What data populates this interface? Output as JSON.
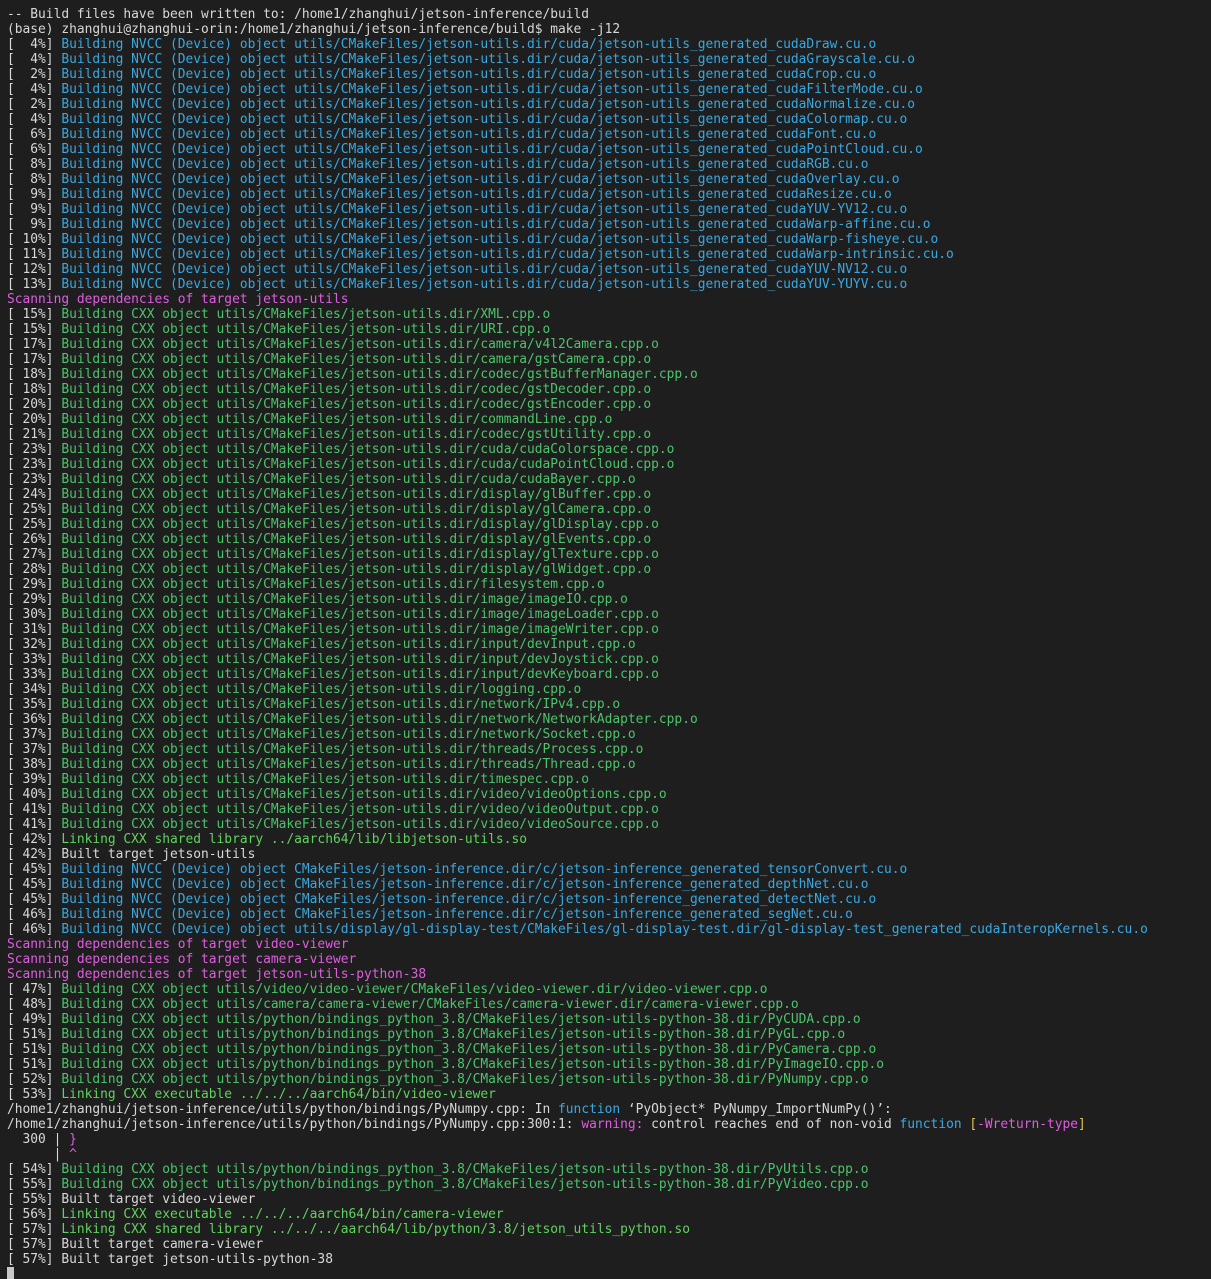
{
  "colors": {
    "background": "#1e1e1e",
    "default": "#d8d8d8",
    "nvcc": "#3aa8e0",
    "cxx": "#4cc46a",
    "scan": "#e05ce0",
    "link": "#5fd35f",
    "warning": "#e05ce0",
    "function_kw": "#3aa8e0",
    "brace": "#e05ce0",
    "flag": "#e05ce0",
    "bracket": "#e0c050"
  },
  "terminal": {
    "lines": [
      [
        {
          "t": "-- Build files have been written to: /home1/zhanghui/jetson-inference/build",
          "c": "default"
        }
      ],
      [
        {
          "t": "(base) zhanghui@zhanghui-orin:/home1/zhanghui/jetson-inference/build$ make -j12",
          "c": "default"
        }
      ],
      [
        {
          "t": "[  4%] ",
          "c": "default"
        },
        {
          "t": "Building NVCC (Device) object utils/CMakeFiles/jetson-utils.dir/cuda/jetson-utils_generated_cudaDraw.cu.o",
          "c": "nvcc"
        }
      ],
      [
        {
          "t": "[  4%] ",
          "c": "default"
        },
        {
          "t": "Building NVCC (Device) object utils/CMakeFiles/jetson-utils.dir/cuda/jetson-utils_generated_cudaGrayscale.cu.o",
          "c": "nvcc"
        }
      ],
      [
        {
          "t": "[  2%] ",
          "c": "default"
        },
        {
          "t": "Building NVCC (Device) object utils/CMakeFiles/jetson-utils.dir/cuda/jetson-utils_generated_cudaCrop.cu.o",
          "c": "nvcc"
        }
      ],
      [
        {
          "t": "[  4%] ",
          "c": "default"
        },
        {
          "t": "Building NVCC (Device) object utils/CMakeFiles/jetson-utils.dir/cuda/jetson-utils_generated_cudaFilterMode.cu.o",
          "c": "nvcc"
        }
      ],
      [
        {
          "t": "[  2%] ",
          "c": "default"
        },
        {
          "t": "Building NVCC (Device) object utils/CMakeFiles/jetson-utils.dir/cuda/jetson-utils_generated_cudaNormalize.cu.o",
          "c": "nvcc"
        }
      ],
      [
        {
          "t": "[  4%] ",
          "c": "default"
        },
        {
          "t": "Building NVCC (Device) object utils/CMakeFiles/jetson-utils.dir/cuda/jetson-utils_generated_cudaColormap.cu.o",
          "c": "nvcc"
        }
      ],
      [
        {
          "t": "[  6%] ",
          "c": "default"
        },
        {
          "t": "Building NVCC (Device) object utils/CMakeFiles/jetson-utils.dir/cuda/jetson-utils_generated_cudaFont.cu.o",
          "c": "nvcc"
        }
      ],
      [
        {
          "t": "[  6%] ",
          "c": "default"
        },
        {
          "t": "Building NVCC (Device) object utils/CMakeFiles/jetson-utils.dir/cuda/jetson-utils_generated_cudaPointCloud.cu.o",
          "c": "nvcc"
        }
      ],
      [
        {
          "t": "[  8%] ",
          "c": "default"
        },
        {
          "t": "Building NVCC (Device) object utils/CMakeFiles/jetson-utils.dir/cuda/jetson-utils_generated_cudaRGB.cu.o",
          "c": "nvcc"
        }
      ],
      [
        {
          "t": "[  8%] ",
          "c": "default"
        },
        {
          "t": "Building NVCC (Device) object utils/CMakeFiles/jetson-utils.dir/cuda/jetson-utils_generated_cudaOverlay.cu.o",
          "c": "nvcc"
        }
      ],
      [
        {
          "t": "[  9%] ",
          "c": "default"
        },
        {
          "t": "Building NVCC (Device) object utils/CMakeFiles/jetson-utils.dir/cuda/jetson-utils_generated_cudaResize.cu.o",
          "c": "nvcc"
        }
      ],
      [
        {
          "t": "[  9%] ",
          "c": "default"
        },
        {
          "t": "Building NVCC (Device) object utils/CMakeFiles/jetson-utils.dir/cuda/jetson-utils_generated_cudaYUV-YV12.cu.o",
          "c": "nvcc"
        }
      ],
      [
        {
          "t": "[  9%] ",
          "c": "default"
        },
        {
          "t": "Building NVCC (Device) object utils/CMakeFiles/jetson-utils.dir/cuda/jetson-utils_generated_cudaWarp-affine.cu.o",
          "c": "nvcc"
        }
      ],
      [
        {
          "t": "[ 10%] ",
          "c": "default"
        },
        {
          "t": "Building NVCC (Device) object utils/CMakeFiles/jetson-utils.dir/cuda/jetson-utils_generated_cudaWarp-fisheye.cu.o",
          "c": "nvcc"
        }
      ],
      [
        {
          "t": "[ 11%] ",
          "c": "default"
        },
        {
          "t": "Building NVCC (Device) object utils/CMakeFiles/jetson-utils.dir/cuda/jetson-utils_generated_cudaWarp-intrinsic.cu.o",
          "c": "nvcc"
        }
      ],
      [
        {
          "t": "[ 12%] ",
          "c": "default"
        },
        {
          "t": "Building NVCC (Device) object utils/CMakeFiles/jetson-utils.dir/cuda/jetson-utils_generated_cudaYUV-NV12.cu.o",
          "c": "nvcc"
        }
      ],
      [
        {
          "t": "[ 13%] ",
          "c": "default"
        },
        {
          "t": "Building NVCC (Device) object utils/CMakeFiles/jetson-utils.dir/cuda/jetson-utils_generated_cudaYUV-YUYV.cu.o",
          "c": "nvcc"
        }
      ],
      [
        {
          "t": "Scanning dependencies of target jetson-utils",
          "c": "scan"
        }
      ],
      [
        {
          "t": "[ 15%] ",
          "c": "default"
        },
        {
          "t": "Building CXX object utils/CMakeFiles/jetson-utils.dir/XML.cpp.o",
          "c": "cxx"
        }
      ],
      [
        {
          "t": "[ 15%] ",
          "c": "default"
        },
        {
          "t": "Building CXX object utils/CMakeFiles/jetson-utils.dir/URI.cpp.o",
          "c": "cxx"
        }
      ],
      [
        {
          "t": "[ 17%] ",
          "c": "default"
        },
        {
          "t": "Building CXX object utils/CMakeFiles/jetson-utils.dir/camera/v4l2Camera.cpp.o",
          "c": "cxx"
        }
      ],
      [
        {
          "t": "[ 17%] ",
          "c": "default"
        },
        {
          "t": "Building CXX object utils/CMakeFiles/jetson-utils.dir/camera/gstCamera.cpp.o",
          "c": "cxx"
        }
      ],
      [
        {
          "t": "[ 18%] ",
          "c": "default"
        },
        {
          "t": "Building CXX object utils/CMakeFiles/jetson-utils.dir/codec/gstBufferManager.cpp.o",
          "c": "cxx"
        }
      ],
      [
        {
          "t": "[ 18%] ",
          "c": "default"
        },
        {
          "t": "Building CXX object utils/CMakeFiles/jetson-utils.dir/codec/gstDecoder.cpp.o",
          "c": "cxx"
        }
      ],
      [
        {
          "t": "[ 20%] ",
          "c": "default"
        },
        {
          "t": "Building CXX object utils/CMakeFiles/jetson-utils.dir/codec/gstEncoder.cpp.o",
          "c": "cxx"
        }
      ],
      [
        {
          "t": "[ 20%] ",
          "c": "default"
        },
        {
          "t": "Building CXX object utils/CMakeFiles/jetson-utils.dir/commandLine.cpp.o",
          "c": "cxx"
        }
      ],
      [
        {
          "t": "[ 21%] ",
          "c": "default"
        },
        {
          "t": "Building CXX object utils/CMakeFiles/jetson-utils.dir/codec/gstUtility.cpp.o",
          "c": "cxx"
        }
      ],
      [
        {
          "t": "[ 23%] ",
          "c": "default"
        },
        {
          "t": "Building CXX object utils/CMakeFiles/jetson-utils.dir/cuda/cudaColorspace.cpp.o",
          "c": "cxx"
        }
      ],
      [
        {
          "t": "[ 23%] ",
          "c": "default"
        },
        {
          "t": "Building CXX object utils/CMakeFiles/jetson-utils.dir/cuda/cudaPointCloud.cpp.o",
          "c": "cxx"
        }
      ],
      [
        {
          "t": "[ 23%] ",
          "c": "default"
        },
        {
          "t": "Building CXX object utils/CMakeFiles/jetson-utils.dir/cuda/cudaBayer.cpp.o",
          "c": "cxx"
        }
      ],
      [
        {
          "t": "[ 24%] ",
          "c": "default"
        },
        {
          "t": "Building CXX object utils/CMakeFiles/jetson-utils.dir/display/glBuffer.cpp.o",
          "c": "cxx"
        }
      ],
      [
        {
          "t": "[ 25%] ",
          "c": "default"
        },
        {
          "t": "Building CXX object utils/CMakeFiles/jetson-utils.dir/display/glCamera.cpp.o",
          "c": "cxx"
        }
      ],
      [
        {
          "t": "[ 25%] ",
          "c": "default"
        },
        {
          "t": "Building CXX object utils/CMakeFiles/jetson-utils.dir/display/glDisplay.cpp.o",
          "c": "cxx"
        }
      ],
      [
        {
          "t": "[ 26%] ",
          "c": "default"
        },
        {
          "t": "Building CXX object utils/CMakeFiles/jetson-utils.dir/display/glEvents.cpp.o",
          "c": "cxx"
        }
      ],
      [
        {
          "t": "[ 27%] ",
          "c": "default"
        },
        {
          "t": "Building CXX object utils/CMakeFiles/jetson-utils.dir/display/glTexture.cpp.o",
          "c": "cxx"
        }
      ],
      [
        {
          "t": "[ 28%] ",
          "c": "default"
        },
        {
          "t": "Building CXX object utils/CMakeFiles/jetson-utils.dir/display/glWidget.cpp.o",
          "c": "cxx"
        }
      ],
      [
        {
          "t": "[ 29%] ",
          "c": "default"
        },
        {
          "t": "Building CXX object utils/CMakeFiles/jetson-utils.dir/filesystem.cpp.o",
          "c": "cxx"
        }
      ],
      [
        {
          "t": "[ 29%] ",
          "c": "default"
        },
        {
          "t": "Building CXX object utils/CMakeFiles/jetson-utils.dir/image/imageIO.cpp.o",
          "c": "cxx"
        }
      ],
      [
        {
          "t": "[ 30%] ",
          "c": "default"
        },
        {
          "t": "Building CXX object utils/CMakeFiles/jetson-utils.dir/image/imageLoader.cpp.o",
          "c": "cxx"
        }
      ],
      [
        {
          "t": "[ 31%] ",
          "c": "default"
        },
        {
          "t": "Building CXX object utils/CMakeFiles/jetson-utils.dir/image/imageWriter.cpp.o",
          "c": "cxx"
        }
      ],
      [
        {
          "t": "[ 32%] ",
          "c": "default"
        },
        {
          "t": "Building CXX object utils/CMakeFiles/jetson-utils.dir/input/devInput.cpp.o",
          "c": "cxx"
        }
      ],
      [
        {
          "t": "[ 33%] ",
          "c": "default"
        },
        {
          "t": "Building CXX object utils/CMakeFiles/jetson-utils.dir/input/devJoystick.cpp.o",
          "c": "cxx"
        }
      ],
      [
        {
          "t": "[ 33%] ",
          "c": "default"
        },
        {
          "t": "Building CXX object utils/CMakeFiles/jetson-utils.dir/input/devKeyboard.cpp.o",
          "c": "cxx"
        }
      ],
      [
        {
          "t": "[ 34%] ",
          "c": "default"
        },
        {
          "t": "Building CXX object utils/CMakeFiles/jetson-utils.dir/logging.cpp.o",
          "c": "cxx"
        }
      ],
      [
        {
          "t": "[ 35%] ",
          "c": "default"
        },
        {
          "t": "Building CXX object utils/CMakeFiles/jetson-utils.dir/network/IPv4.cpp.o",
          "c": "cxx"
        }
      ],
      [
        {
          "t": "[ 36%] ",
          "c": "default"
        },
        {
          "t": "Building CXX object utils/CMakeFiles/jetson-utils.dir/network/NetworkAdapter.cpp.o",
          "c": "cxx"
        }
      ],
      [
        {
          "t": "[ 37%] ",
          "c": "default"
        },
        {
          "t": "Building CXX object utils/CMakeFiles/jetson-utils.dir/network/Socket.cpp.o",
          "c": "cxx"
        }
      ],
      [
        {
          "t": "[ 37%] ",
          "c": "default"
        },
        {
          "t": "Building CXX object utils/CMakeFiles/jetson-utils.dir/threads/Process.cpp.o",
          "c": "cxx"
        }
      ],
      [
        {
          "t": "[ 38%] ",
          "c": "default"
        },
        {
          "t": "Building CXX object utils/CMakeFiles/jetson-utils.dir/threads/Thread.cpp.o",
          "c": "cxx"
        }
      ],
      [
        {
          "t": "[ 39%] ",
          "c": "default"
        },
        {
          "t": "Building CXX object utils/CMakeFiles/jetson-utils.dir/timespec.cpp.o",
          "c": "cxx"
        }
      ],
      [
        {
          "t": "[ 40%] ",
          "c": "default"
        },
        {
          "t": "Building CXX object utils/CMakeFiles/jetson-utils.dir/video/videoOptions.cpp.o",
          "c": "cxx"
        }
      ],
      [
        {
          "t": "[ 41%] ",
          "c": "default"
        },
        {
          "t": "Building CXX object utils/CMakeFiles/jetson-utils.dir/video/videoOutput.cpp.o",
          "c": "cxx"
        }
      ],
      [
        {
          "t": "[ 41%] ",
          "c": "default"
        },
        {
          "t": "Building CXX object utils/CMakeFiles/jetson-utils.dir/video/videoSource.cpp.o",
          "c": "cxx"
        }
      ],
      [
        {
          "t": "[ 42%] ",
          "c": "default"
        },
        {
          "t": "Linking CXX shared library ../aarch64/lib/libjetson-utils.so",
          "c": "link"
        }
      ],
      [
        {
          "t": "[ 42%] Built target jetson-utils",
          "c": "default"
        }
      ],
      [
        {
          "t": "[ 45%] ",
          "c": "default"
        },
        {
          "t": "Building NVCC (Device) object CMakeFiles/jetson-inference.dir/c/jetson-inference_generated_tensorConvert.cu.o",
          "c": "nvcc"
        }
      ],
      [
        {
          "t": "[ 45%] ",
          "c": "default"
        },
        {
          "t": "Building NVCC (Device) object CMakeFiles/jetson-inference.dir/c/jetson-inference_generated_depthNet.cu.o",
          "c": "nvcc"
        }
      ],
      [
        {
          "t": "[ 45%] ",
          "c": "default"
        },
        {
          "t": "Building NVCC (Device) object CMakeFiles/jetson-inference.dir/c/jetson-inference_generated_detectNet.cu.o",
          "c": "nvcc"
        }
      ],
      [
        {
          "t": "[ 46%] ",
          "c": "default"
        },
        {
          "t": "Building NVCC (Device) object CMakeFiles/jetson-inference.dir/c/jetson-inference_generated_segNet.cu.o",
          "c": "nvcc"
        }
      ],
      [
        {
          "t": "[ 46%] ",
          "c": "default"
        },
        {
          "t": "Building NVCC (Device) object utils/display/gl-display-test/CMakeFiles/gl-display-test.dir/gl-display-test_generated_cudaInteropKernels.cu.o",
          "c": "nvcc"
        }
      ],
      [
        {
          "t": "Scanning dependencies of target video-viewer",
          "c": "scan"
        }
      ],
      [
        {
          "t": "Scanning dependencies of target camera-viewer",
          "c": "scan"
        }
      ],
      [
        {
          "t": "Scanning dependencies of target jetson-utils-python-38",
          "c": "scan"
        }
      ],
      [
        {
          "t": "[ 47%] ",
          "c": "default"
        },
        {
          "t": "Building CXX object utils/video/video-viewer/CMakeFiles/video-viewer.dir/video-viewer.cpp.o",
          "c": "cxx"
        }
      ],
      [
        {
          "t": "[ 48%] ",
          "c": "default"
        },
        {
          "t": "Building CXX object utils/camera/camera-viewer/CMakeFiles/camera-viewer.dir/camera-viewer.cpp.o",
          "c": "cxx"
        }
      ],
      [
        {
          "t": "[ 49%] ",
          "c": "default"
        },
        {
          "t": "Building CXX object utils/python/bindings_python_3.8/CMakeFiles/jetson-utils-python-38.dir/PyCUDA.cpp.o",
          "c": "cxx"
        }
      ],
      [
        {
          "t": "[ 51%] ",
          "c": "default"
        },
        {
          "t": "Building CXX object utils/python/bindings_python_3.8/CMakeFiles/jetson-utils-python-38.dir/PyGL.cpp.o",
          "c": "cxx"
        }
      ],
      [
        {
          "t": "[ 51%] ",
          "c": "default"
        },
        {
          "t": "Building CXX object utils/python/bindings_python_3.8/CMakeFiles/jetson-utils-python-38.dir/PyCamera.cpp.o",
          "c": "cxx"
        }
      ],
      [
        {
          "t": "[ 51%] ",
          "c": "default"
        },
        {
          "t": "Building CXX object utils/python/bindings_python_3.8/CMakeFiles/jetson-utils-python-38.dir/PyImageIO.cpp.o",
          "c": "cxx"
        }
      ],
      [
        {
          "t": "[ 52%] ",
          "c": "default"
        },
        {
          "t": "Building CXX object utils/python/bindings_python_3.8/CMakeFiles/jetson-utils-python-38.dir/PyNumpy.cpp.o",
          "c": "cxx"
        }
      ],
      [
        {
          "t": "[ 53%] ",
          "c": "default"
        },
        {
          "t": "Linking CXX executable ../../../aarch64/bin/video-viewer",
          "c": "link"
        }
      ],
      [
        {
          "t": "/home1/zhanghui/jetson-inference/utils/python/bindings/PyNumpy.cpp: In ",
          "c": "default"
        },
        {
          "t": "function",
          "c": "function_kw"
        },
        {
          "t": " ‘PyObject* PyNumpy_ImportNumPy()’:",
          "c": "default"
        }
      ],
      [
        {
          "t": "/home1/zhanghui/jetson-inference/utils/python/bindings/PyNumpy.cpp:300:1: ",
          "c": "default"
        },
        {
          "t": "warning:",
          "c": "warning"
        },
        {
          "t": " control reaches end of non-void ",
          "c": "default"
        },
        {
          "t": "function",
          "c": "function_kw"
        },
        {
          "t": " ",
          "c": "default"
        },
        {
          "t": "[",
          "c": "bracket"
        },
        {
          "t": "-Wreturn-type",
          "c": "flag"
        },
        {
          "t": "]",
          "c": "bracket"
        }
      ],
      [
        {
          "t": "  300 | ",
          "c": "default"
        },
        {
          "t": "}",
          "c": "brace"
        }
      ],
      [
        {
          "t": "      | ",
          "c": "default"
        },
        {
          "t": "^",
          "c": "brace"
        }
      ],
      [
        {
          "t": "[ 54%] ",
          "c": "default"
        },
        {
          "t": "Building CXX object utils/python/bindings_python_3.8/CMakeFiles/jetson-utils-python-38.dir/PyUtils.cpp.o",
          "c": "cxx"
        }
      ],
      [
        {
          "t": "[ 55%] ",
          "c": "default"
        },
        {
          "t": "Building CXX object utils/python/bindings_python_3.8/CMakeFiles/jetson-utils-python-38.dir/PyVideo.cpp.o",
          "c": "cxx"
        }
      ],
      [
        {
          "t": "[ 55%] Built target video-viewer",
          "c": "default"
        }
      ],
      [
        {
          "t": "[ 56%] ",
          "c": "default"
        },
        {
          "t": "Linking CXX executable ../../../aarch64/bin/camera-viewer",
          "c": "link"
        }
      ],
      [
        {
          "t": "[ 57%] ",
          "c": "default"
        },
        {
          "t": "Linking CXX shared library ../../../aarch64/lib/python/3.8/jetson_utils_python.so",
          "c": "link"
        }
      ],
      [
        {
          "t": "[ 57%] Built target camera-viewer",
          "c": "default"
        }
      ],
      [
        {
          "t": "[ 57%] Built target jetson-utils-python-38",
          "c": "default"
        }
      ]
    ]
  }
}
